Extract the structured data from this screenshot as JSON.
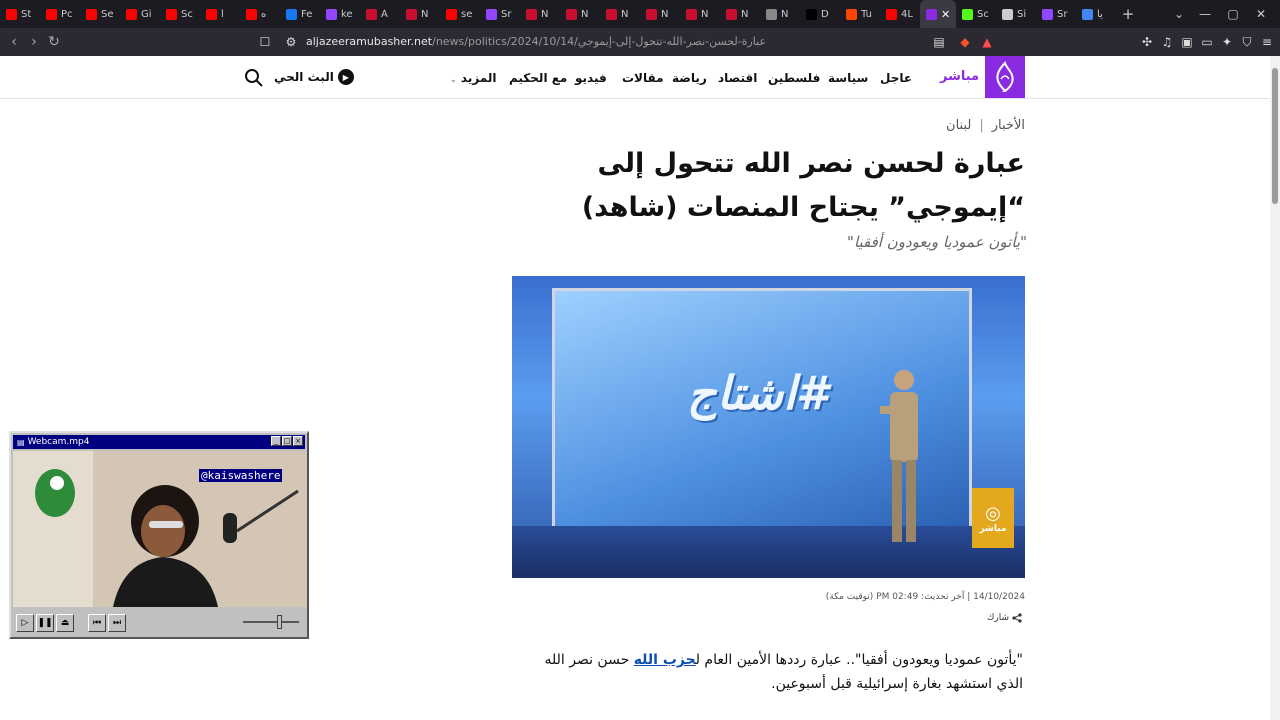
{
  "browser": {
    "tabs": [
      {
        "title": "St",
        "color": "#ff0000"
      },
      {
        "title": "Pc",
        "color": "#ff0000"
      },
      {
        "title": "Se",
        "color": "#ff0000"
      },
      {
        "title": "Gi",
        "color": "#ff0000"
      },
      {
        "title": "Sc",
        "color": "#ff0000"
      },
      {
        "title": "أ",
        "color": "#ff0000"
      },
      {
        "title": "ه",
        "color": "#ff0000"
      },
      {
        "title": "Fe",
        "color": "#1877f2"
      },
      {
        "title": "ke",
        "color": "#9146ff"
      },
      {
        "title": "À",
        "color": "#c8102e"
      },
      {
        "title": "N",
        "color": "#c8102e"
      },
      {
        "title": "se",
        "color": "#ff0000"
      },
      {
        "title": "Sr",
        "color": "#9146ff"
      },
      {
        "title": "N",
        "color": "#c8102e"
      },
      {
        "title": "N",
        "color": "#c8102e"
      },
      {
        "title": "N",
        "color": "#c8102e"
      },
      {
        "title": "N",
        "color": "#c8102e"
      },
      {
        "title": "N",
        "color": "#c8102e"
      },
      {
        "title": "N",
        "color": "#c8102e"
      },
      {
        "title": "N",
        "color": "#888888"
      },
      {
        "title": "D",
        "color": "#000000"
      },
      {
        "title": "Tu",
        "color": "#ff4500"
      },
      {
        "title": "4L",
        "color": "#ff0000"
      }
    ],
    "active_tab": {
      "title": "",
      "close": "✕"
    },
    "tabs_after": [
      {
        "title": "Sc",
        "color": "#53fc18"
      },
      {
        "title": "Si",
        "color": "#cccccc"
      },
      {
        "title": "Sr",
        "color": "#9146ff"
      },
      {
        "title": "يا",
        "color": "#4285f4"
      }
    ],
    "new_tab": "+",
    "url_host": "aljazeeramubasher.net",
    "url_path": "/news/politics/2024/10/14/عبارة-لحسن-نصر-الله-تتحول-إلى-إيموجي",
    "window_controls": {
      "dropdown": "⌄",
      "minimize": "—",
      "maximize": "▢",
      "close": "✕"
    }
  },
  "site": {
    "brand": "مباشر",
    "nav": [
      "عاجل",
      "سياسة",
      "فلسطين",
      "اقتصاد",
      "رياضة",
      "مقالات",
      "فيديو",
      "مع الحكيم",
      "المزيد"
    ],
    "live_label": "البث الحي"
  },
  "article": {
    "breadcrumb": [
      "الأخبار",
      "لبنان"
    ],
    "headline": "عبارة لحسن نصر الله تتحول إلى “إيموجي” يجتاح المنصات (شاهد)",
    "subhead": "\"يأتون عموديا ويعودون أفقيا\"",
    "hero_hashtag": "#اشتاج",
    "hero_watermark": "مباشر",
    "date": "14/10/2024",
    "updated": "آخر تحديث: 02:49 PM (توقيت مكة)",
    "share_label": "شارك",
    "body_before": "\"يأتون عموديا ويعودون أفقيا\".. عبارة رددها الأمين العام ل",
    "body_link": "حزب الله",
    "body_after": " حسن نصر الله الذي استشهد بغارة إسرائيلية قبل أسبوعين."
  },
  "webcam": {
    "title": "Webcam.mp4",
    "handle": "@kaiswashere"
  }
}
